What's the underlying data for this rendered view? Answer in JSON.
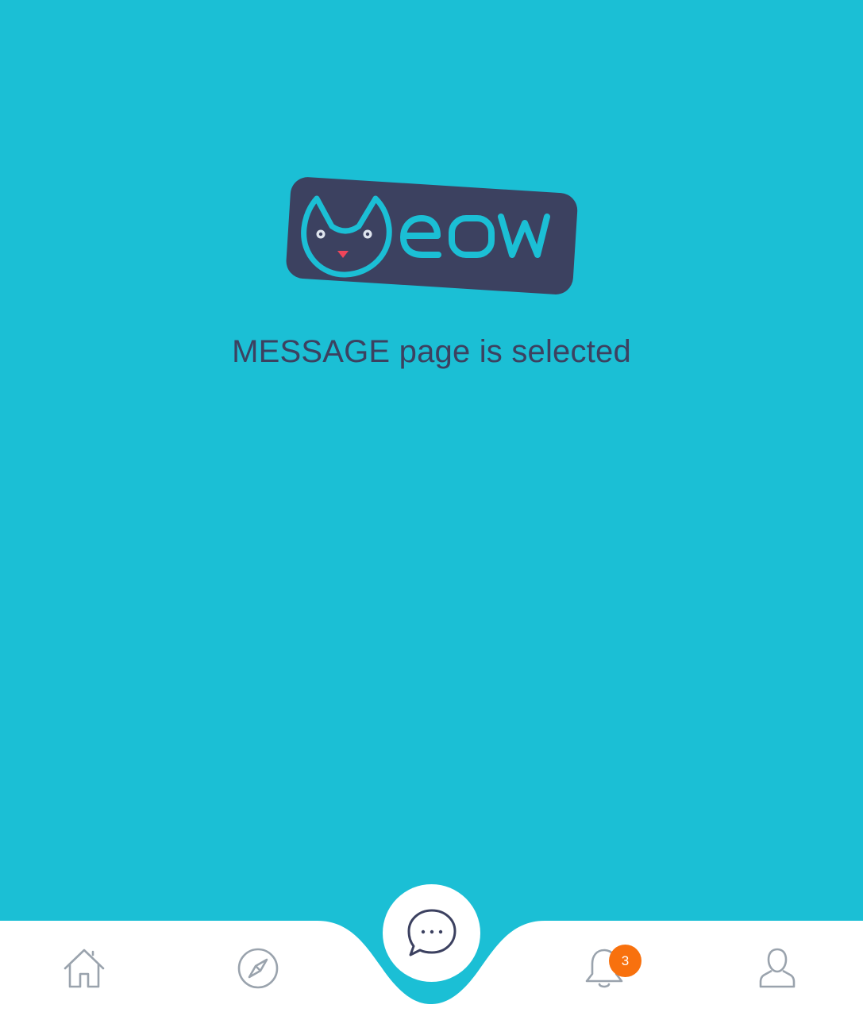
{
  "app": {
    "logo_text": "Meow",
    "status_message": "MESSAGE page is selected"
  },
  "colors": {
    "background": "#1bbfd5",
    "logo_plate": "#3c4160",
    "nav_background": "#ffffff",
    "nav_icon": "#9aa3ad",
    "fab_icon": "#3c4160",
    "badge": "#f8710e"
  },
  "bottom_nav": {
    "items": [
      {
        "id": "home",
        "icon": "home-icon",
        "label": "Home",
        "selected": false
      },
      {
        "id": "explore",
        "icon": "compass-icon",
        "label": "Explore",
        "selected": false
      },
      {
        "id": "message",
        "icon": "chat-bubble-icon",
        "label": "Message",
        "selected": true
      },
      {
        "id": "notifications",
        "icon": "bell-icon",
        "label": "Notifications",
        "selected": false,
        "badge": "3"
      },
      {
        "id": "profile",
        "icon": "user-icon",
        "label": "Profile",
        "selected": false
      }
    ]
  }
}
